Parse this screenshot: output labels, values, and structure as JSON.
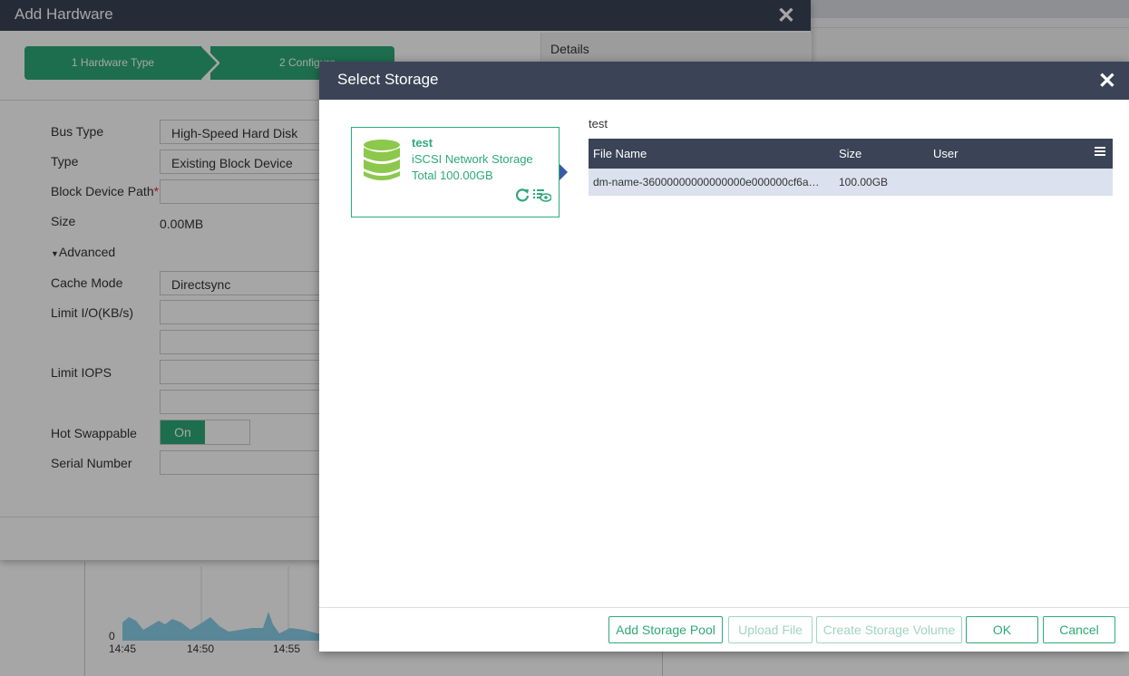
{
  "add_hardware": {
    "title": "Add Hardware",
    "steps": [
      {
        "label": "1 Hardware Type"
      },
      {
        "label": "2 Configure"
      }
    ],
    "details_tab": "Details",
    "fields": {
      "bus_type_label": "Bus Type",
      "bus_type_value": "High-Speed Hard Disk",
      "type_label": "Type",
      "type_value": "Existing Block Device",
      "block_path_label": "Block Device Path",
      "block_path_required": "*",
      "size_label": "Size",
      "size_value": "0.00MB",
      "advanced_label": "Advanced",
      "cache_mode_label": "Cache Mode",
      "cache_mode_value": "Directsync",
      "limit_io_label": "Limit I/O(KB/s)",
      "limit_iops_label": "Limit IOPS",
      "hot_swappable_label": "Hot Swappable",
      "hot_swappable_value": "On",
      "serial_number_label": "Serial Number"
    }
  },
  "background_chart": {
    "zero_label": "0",
    "ticks": [
      "14:45",
      "14:50",
      "14:55"
    ]
  },
  "select_storage": {
    "title": "Select Storage",
    "pool_card": {
      "name": "test",
      "kind": "iSCSI Network Storage",
      "total": "Total 100.00GB"
    },
    "pool_title": "test",
    "table": {
      "headers": {
        "file_name": "File Name",
        "size": "Size",
        "user": "User"
      },
      "rows": [
        {
          "file_name": "dm-name-36000000000000000e000000cf6a…",
          "size": "100.00GB",
          "user": ""
        }
      ]
    },
    "buttons": {
      "add_storage_pool": "Add Storage Pool",
      "upload_file": "Upload File",
      "create_storage_volume": "Create Storage Volume",
      "ok": "OK",
      "cancel": "Cancel"
    }
  },
  "colors": {
    "header_bg": "#3a4456",
    "accent_green": "#2daa78",
    "selected_row": "#dbe1ee"
  }
}
